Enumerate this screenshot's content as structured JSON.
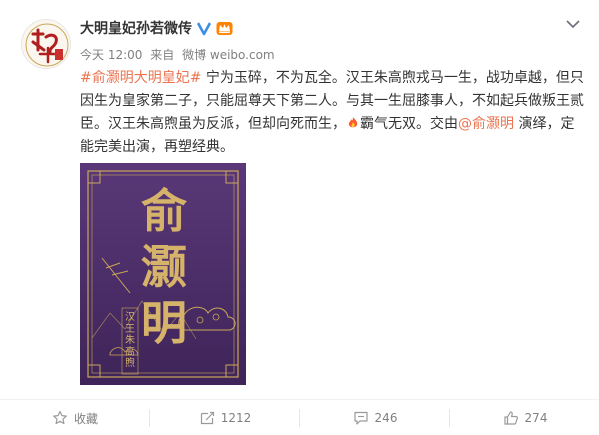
{
  "post": {
    "author": "大明皇妃孙若微传",
    "time": "今天 12:00",
    "source_prefix": "来自",
    "source": "微博 weibo.com",
    "content": {
      "hashtag": "#俞灏明大明皇妃#",
      "text1": " 宁为玉碎，不为瓦全。汉王朱高煦戎马一生，战功卓越，但只因生为皇家第二子，只能屈尊天下第二人。与其一生屈膝事人，不如起兵做叛王贰臣。汉王朱高煦虽为反派，但却向死而生，",
      "text2": "霸气无双。交由",
      "mention": "@俞灏明",
      "text3": " 演绎，定能完美出演，再塑经典。"
    },
    "poster": {
      "title_chars": [
        "俞",
        "灏",
        "明"
      ],
      "subtitle": "汉王朱高煦"
    },
    "actions": {
      "favorite": "收藏",
      "repost": "1212",
      "comment": "246",
      "like": "274"
    }
  },
  "colors": {
    "link": "#eb7350",
    "poster_bg": "#4b2c6b",
    "poster_gold": "#c9a75a"
  }
}
